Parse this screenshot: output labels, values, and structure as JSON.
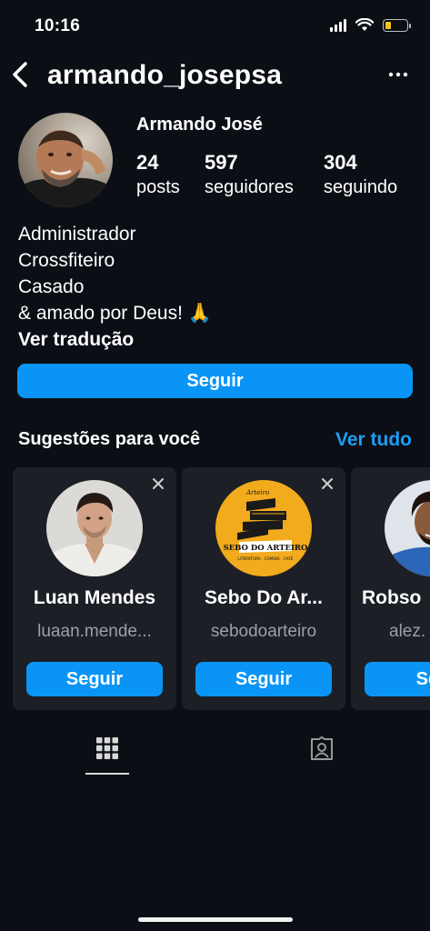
{
  "status": {
    "time": "10:16"
  },
  "header": {
    "username": "armando_josepsa"
  },
  "profile": {
    "name": "Armando José",
    "posts": "24",
    "posts_label": "posts",
    "followers": "597",
    "followers_label": "seguidores",
    "following": "304",
    "following_label": "seguindo",
    "bio": [
      "Administrador",
      "Crossfiteiro",
      "Casado",
      "& amado por Deus! 🙏"
    ],
    "translate": "Ver tradução",
    "follow_label": "Seguir"
  },
  "suggestions": {
    "title": "Sugestões para você",
    "see_all": "Ver tudo",
    "cards": [
      {
        "name": "Luan Mendes",
        "handle": "luaan.mende...",
        "follow": "Seguir"
      },
      {
        "name": "Sebo Do Ar...",
        "handle": "sebodoarteiro",
        "follow": "Seguir",
        "logo_title": "SEBO DO ARTEIRO",
        "logo_sub": "LITERATURA · COMIDA · CAFÉ",
        "logo_top": "Arteiro"
      },
      {
        "name": "Robso",
        "handle": "alez.",
        "follow": "Seg"
      }
    ]
  },
  "colors": {
    "accent": "#0a95f6",
    "link": "#1f9cf4",
    "background": "#0b0f15",
    "card": "#1c1f26"
  },
  "icons": [
    "back-icon",
    "more-icon",
    "close-icon",
    "grid-icon",
    "tagged-icon",
    "wifi-icon",
    "signal-icon",
    "battery-icon"
  ]
}
